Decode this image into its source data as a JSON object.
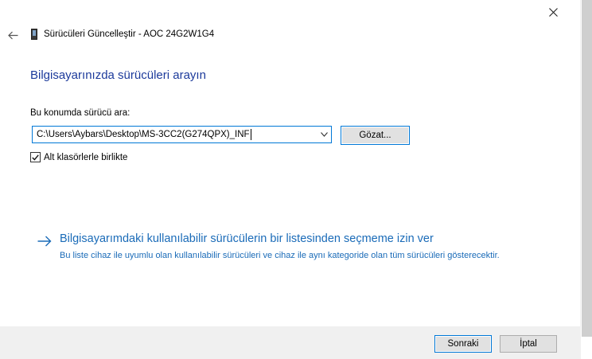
{
  "window": {
    "title": "Sürücüleri Güncelleştir - AOC 24G2W1G4"
  },
  "main": {
    "heading": "Bilgisayarınızda sürücüleri arayın",
    "field_label": "Bu konumda sürücü ara:",
    "path_value": "C:\\Users\\Aybars\\Desktop\\MS-3CC2(G274QPX)_INF",
    "browse_label": "Gözat...",
    "include_subfolders_label": "Alt klasörlerle birlikte",
    "include_subfolders_checked": true,
    "link_title": "Bilgisayarımdaki kullanılabilir sürücülerin bir listesinden seçmeme izin ver",
    "link_description": "Bu liste cihaz ile uyumlu olan kullanılabilir sürücüleri ve cihaz ile aynı kategoride olan tüm sürücüleri gösterecektir."
  },
  "footer": {
    "next_label": "Sonraki",
    "cancel_label": "İptal"
  },
  "colors": {
    "accent": "#0078d7",
    "heading": "#1c3a9b",
    "link": "#1a6bb8"
  },
  "icons": {
    "close": "close-icon",
    "back": "back-arrow-icon",
    "device": "device-icon",
    "link_arrow": "right-arrow-icon",
    "dropdown": "chevron-down-icon",
    "checkbox": "checkmark-icon"
  }
}
